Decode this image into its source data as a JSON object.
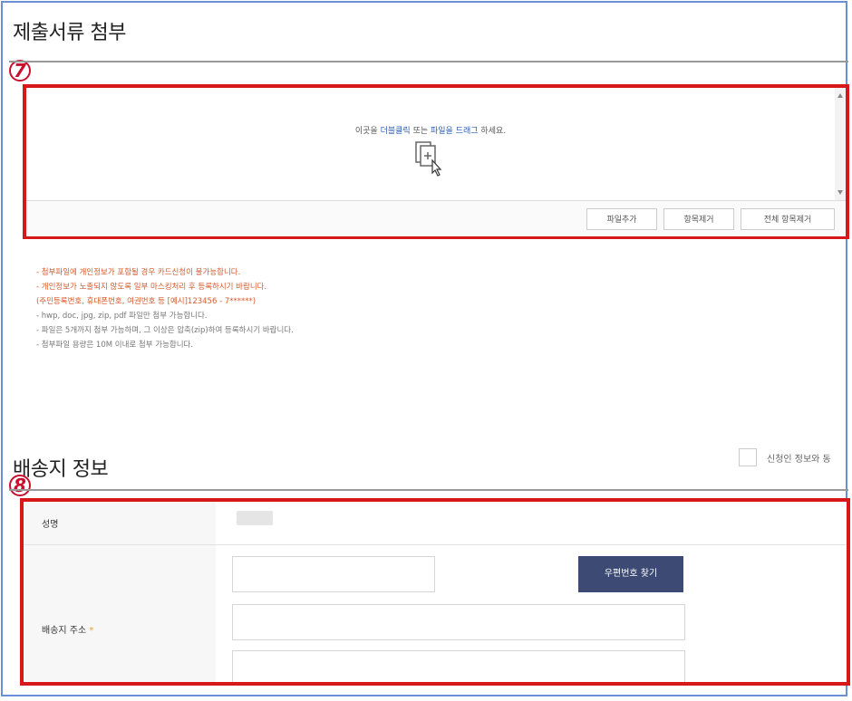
{
  "attach": {
    "title": "제출서류 첨부",
    "marker": "7",
    "drop_prefix": "이곳을 ",
    "drop_link1": "더블클릭",
    "drop_mid": " 또는 ",
    "drop_link2": "파일을 드래그",
    "drop_suffix": " 하세요.",
    "btn_add": "파일추가",
    "btn_remove": "항목제거",
    "btn_remove_all": "전체 항목제거",
    "notes_red": [
      "- 첨부파일에 개인정보가 포함될 경우 카드신청이 불가능합니다.",
      "- 개인정보가 노출되지 않도록 일부 마스킹처리 후 등록하시기 바랍니다.",
      "  (주민등록번호, 휴대폰번호, 여권번호 등 [예시]123456 - 7******)"
    ],
    "notes_gray": [
      "- hwp, doc, jpg, zip, pdf 파일만 첨부 가능합니다.",
      "- 파일은 5개까지 첨부 가능하며, 그 이상은 압축(zip)하여 등록하시기 바랍니다.",
      "- 첨부파일 용량은 10M 이내로 첨부 가능합니다."
    ]
  },
  "shipping": {
    "title": "배송지 정보",
    "marker": "8",
    "same_as_applicant": "신청인 정보와 동",
    "name_label": "성명",
    "address_label": "배송지 주소",
    "required_mark": "*",
    "zip_button": "우편번호 찾기"
  }
}
